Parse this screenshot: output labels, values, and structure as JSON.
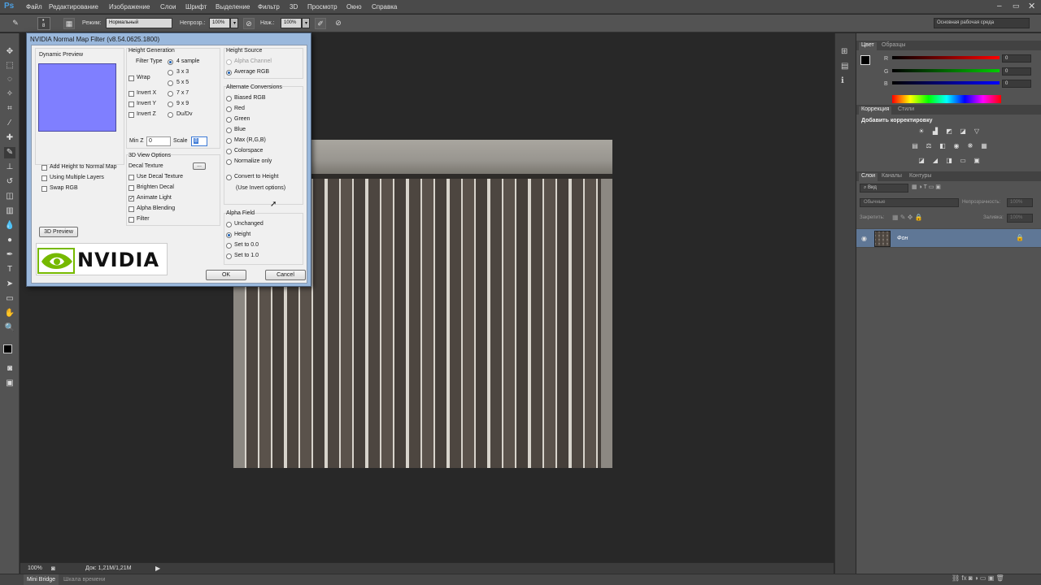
{
  "app": {
    "logo": "Ps"
  },
  "menubar": [
    "Файл",
    "Редактирование",
    "Изображение",
    "Слои",
    "Шрифт",
    "Выделение",
    "Фильтр",
    "3D",
    "Просмотр",
    "Окно",
    "Справка"
  ],
  "options": {
    "brush_size": "8",
    "mode_label": "Режим:",
    "mode_value": "Нормальный",
    "opacity_label": "Непрозр.:",
    "opacity_value": "100%",
    "flow_label": "Наж.:",
    "flow_value": "100%",
    "workspace": "Основная рабочая среда"
  },
  "dialog": {
    "title": "NVIDIA Normal Map Filter (v8.54.0625.1800)",
    "dynamic_preview": "Dynamic Preview",
    "height_generation": "Height Generation",
    "filter_type": "Filter Type",
    "filter_options": [
      "4 sample",
      "3 x 3",
      "5 x 5",
      "7 x 7",
      "9 x 9",
      "Du/Dv"
    ],
    "filter_selected": 0,
    "wrap": "Wrap",
    "invert_x": "Invert X",
    "invert_y": "Invert Y",
    "invert_z": "Invert Z",
    "min_z_label": "Min Z",
    "min_z_value": "0",
    "scale_label": "Scale",
    "scale_value": "8",
    "view_options": "3D View Options",
    "decal_texture": "Decal Texture",
    "decal_browse": "...",
    "view_checks": [
      {
        "label": "Use Decal Texture",
        "checked": false
      },
      {
        "label": "Brighten Decal",
        "checked": false
      },
      {
        "label": "Animate Light",
        "checked": true
      },
      {
        "label": "Alpha Blending",
        "checked": false
      },
      {
        "label": "Filter",
        "checked": false
      }
    ],
    "left_checks": [
      "Add Height to Normal Map",
      "Using Multiple Layers",
      "Swap RGB"
    ],
    "preview_3d": "3D Preview",
    "height_source": "Height Source",
    "height_source_options": [
      "Alpha Channel",
      "Average RGB"
    ],
    "alt_conversions": "Alternate Conversions",
    "alt_options": [
      "Biased RGB",
      "Red",
      "Green",
      "Blue",
      "Max (R,G,B)",
      "Colorspace",
      "Normalize only"
    ],
    "convert_to_height": "Convert to Height",
    "use_invert": "(Use Invert options)",
    "alpha_field": "Alpha Field",
    "alpha_options": [
      "Unchanged",
      "Height",
      "Set to 0.0",
      "Set to 1.0"
    ],
    "alpha_selected": 1,
    "ok": "OK",
    "cancel": "Cancel",
    "logo_text": "NVIDIA"
  },
  "right": {
    "color_tabs": [
      "Цвет",
      "Образцы"
    ],
    "rgb": [
      {
        "label": "R",
        "value": "0",
        "color": "#e02020"
      },
      {
        "label": "G",
        "value": "0",
        "color": "#20b030"
      },
      {
        "label": "B",
        "value": "0",
        "color": "#2040e0"
      }
    ],
    "adj_tabs": [
      "Коррекция",
      "Стили"
    ],
    "adj_title": "Добавить корректировку",
    "layer_tabs": [
      "Слои",
      "Каналы",
      "Контуры"
    ],
    "kind_label": "Вид",
    "blend_mode": "Обычные",
    "opacity_label": "Непрозрачность:",
    "opacity_value": "100%",
    "lock_label": "Закрепить:",
    "fill_label": "Заливка:",
    "fill_value": "100%",
    "layer_name": "Фон"
  },
  "status": {
    "zoom": "100%",
    "doc": "Док: 1,21M/1,21M"
  },
  "bottom_tabs": [
    "Mini Bridge",
    "Шкала времени"
  ]
}
